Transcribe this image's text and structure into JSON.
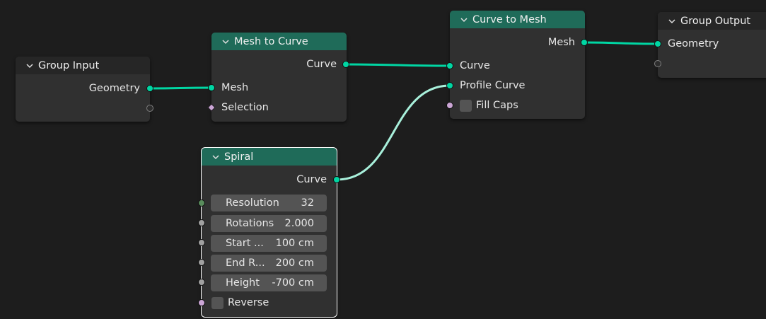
{
  "nodes": {
    "group_input": {
      "title": "Group Input",
      "outputs": [
        "Geometry"
      ]
    },
    "mesh_to_curve": {
      "title": "Mesh to Curve",
      "outputs": [
        "Curve"
      ],
      "inputs": [
        "Mesh",
        "Selection"
      ]
    },
    "curve_to_mesh": {
      "title": "Curve to Mesh",
      "outputs": [
        "Mesh"
      ],
      "inputs": [
        "Curve",
        "Profile Curve"
      ],
      "fill_caps_label": "Fill Caps"
    },
    "group_output": {
      "title": "Group Output",
      "inputs": [
        "Geometry"
      ]
    },
    "spiral": {
      "title": "Spiral",
      "outputs": [
        "Curve"
      ],
      "fields": [
        {
          "label": "Resolution",
          "value": "32"
        },
        {
          "label": "Rotations",
          "value": "2.000"
        },
        {
          "label": "Start ...",
          "value": "100 cm"
        },
        {
          "label": "End R...",
          "value": "200 cm"
        },
        {
          "label": "Height",
          "value": "-700 cm"
        }
      ],
      "reverse_label": "Reverse"
    }
  },
  "colors": {
    "header_teal": "#1f6b59",
    "geometry_socket": "#00d6a3",
    "boolean_socket": "#cca6d6",
    "integer_socket": "#598c5c",
    "float_socket": "#a1a1a1",
    "wire": "#00d6a3",
    "wire_selected": "#a8f0db"
  }
}
